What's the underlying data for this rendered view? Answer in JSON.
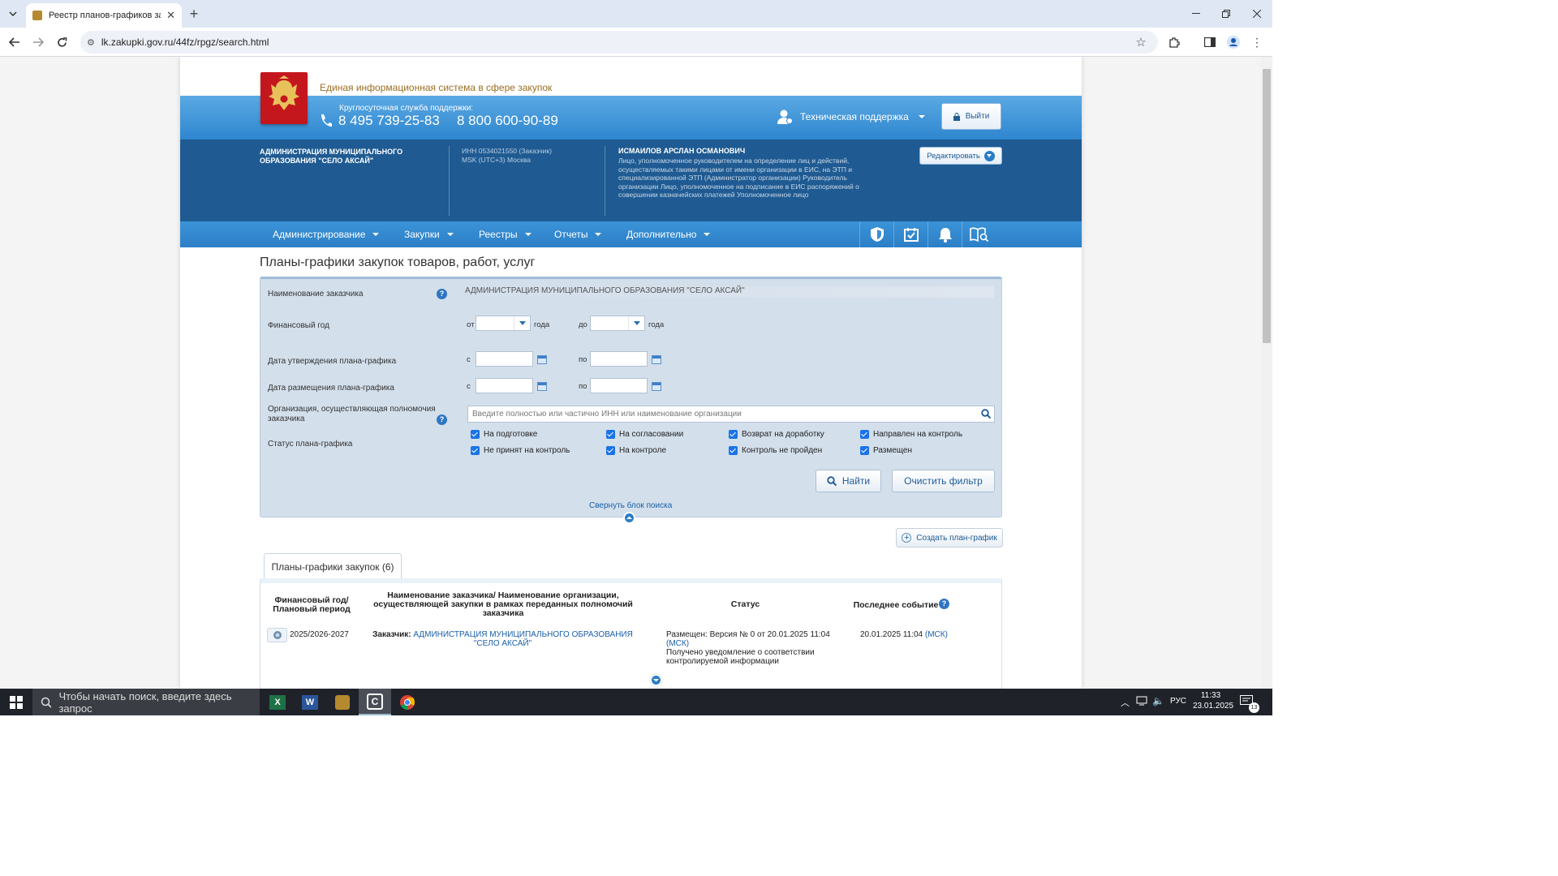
{
  "browser": {
    "tab_title": "Реестр планов-графиков зак",
    "url": "lk.zakupki.gov.ru/44fz/rpgz/search.html"
  },
  "header": {
    "eis_title": "Единая информационная система в сфере закупок",
    "support_label": "Круглосуточная служба поддержки:",
    "phone1": "8 495 739-25-83",
    "phone2": "8 800 600-90-89",
    "tech_support": "Техническая поддержка",
    "logout": "Выйти"
  },
  "org": {
    "name": "АДМИНИСТРАЦИЯ МУНИЦИПАЛЬНОГО ОБРАЗОВАНИЯ \"СЕЛО АКСАЙ\"",
    "inn": "ИНН 0534021550 (Заказчик)",
    "timezone": "MSK (UTC+3) Москва",
    "user_name": "ИСМАИЛОВ АРСЛАН ОСМАНОВИЧ",
    "roles": "Лицо, уполномоченное руководителем на определение лиц и действий, осуществляемых такими лицами от имени организации в ЕИС, на ЭТП и специализированной ЭТП (Администратор организации) Руководитель организации Лицо, уполномоченное на подписание в ЕИС распоряжений о совершении казначейских платежей Уполномоченное лицо",
    "edit": "Редактировать"
  },
  "nav": [
    "Администрирование",
    "Закупки",
    "Реестры",
    "Отчеты",
    "Дополнительно"
  ],
  "page_title": "Планы-графики закупок товаров, работ, услуг",
  "search": {
    "customer_label": "Наименование заказчика",
    "customer_value": "АДМИНИСТРАЦИЯ МУНИЦИПАЛЬНОГО ОБРАЗОВАНИЯ \"СЕЛО АКСАЙ\"",
    "fin_year_label": "Финансовый год",
    "from": "от",
    "to": "до",
    "year_word": "года",
    "approve_date_label": "Дата утверждения плана-графика",
    "publish_date_label": "Дата размещения плана-графика",
    "s": "с",
    "po": "по",
    "org_label": "Организация, осуществляющая полномочия заказчика",
    "org_placeholder": "Введите полностью или частично ИНН или наименование организации",
    "status_label": "Статус плана-графика",
    "statuses": [
      "На подготовке",
      "На согласовании",
      "Возврат на доработку",
      "Направлен на контроль",
      "Не принят на контроль",
      "На контроле",
      "Контроль не пройден",
      "Размещен"
    ],
    "find": "Найти",
    "clear": "Очистить фильтр",
    "collapse": "Свернуть блок поиска"
  },
  "create_plan": "Создать план-график",
  "results_tab": "Планы-графики закупок (6)",
  "table": {
    "col_year": "Финансовый год/ Плановый период",
    "col_customer": "Наименование заказчика/ Наименование организации, осуществляющей закупки в рамках переданных полномочий заказчика",
    "col_status": "Статус",
    "col_event": "Последнее событие",
    "rows": [
      {
        "period": "2025/2026-2027",
        "customer_prefix": "Заказчик:",
        "customer": "АДМИНИСТРАЦИЯ МУНИЦИПАЛЬНОГО ОБРАЗОВАНИЯ \"СЕЛО АКСАЙ\"",
        "status_line1": "Размещен: Версия № 0 от 20.01.2025 11:04",
        "status_msk": "(МСК)",
        "status_line2": "Получено уведомление о соответствии контролируемой информации",
        "event": "20.01.2025 11:04",
        "event_msk": "(МСК)"
      }
    ]
  },
  "taskbar": {
    "search_placeholder": "Чтобы начать поиск, введите здесь запрос",
    "lang": "РУС",
    "time": "11:33",
    "date": "23.01.2025",
    "notifications": "13"
  }
}
